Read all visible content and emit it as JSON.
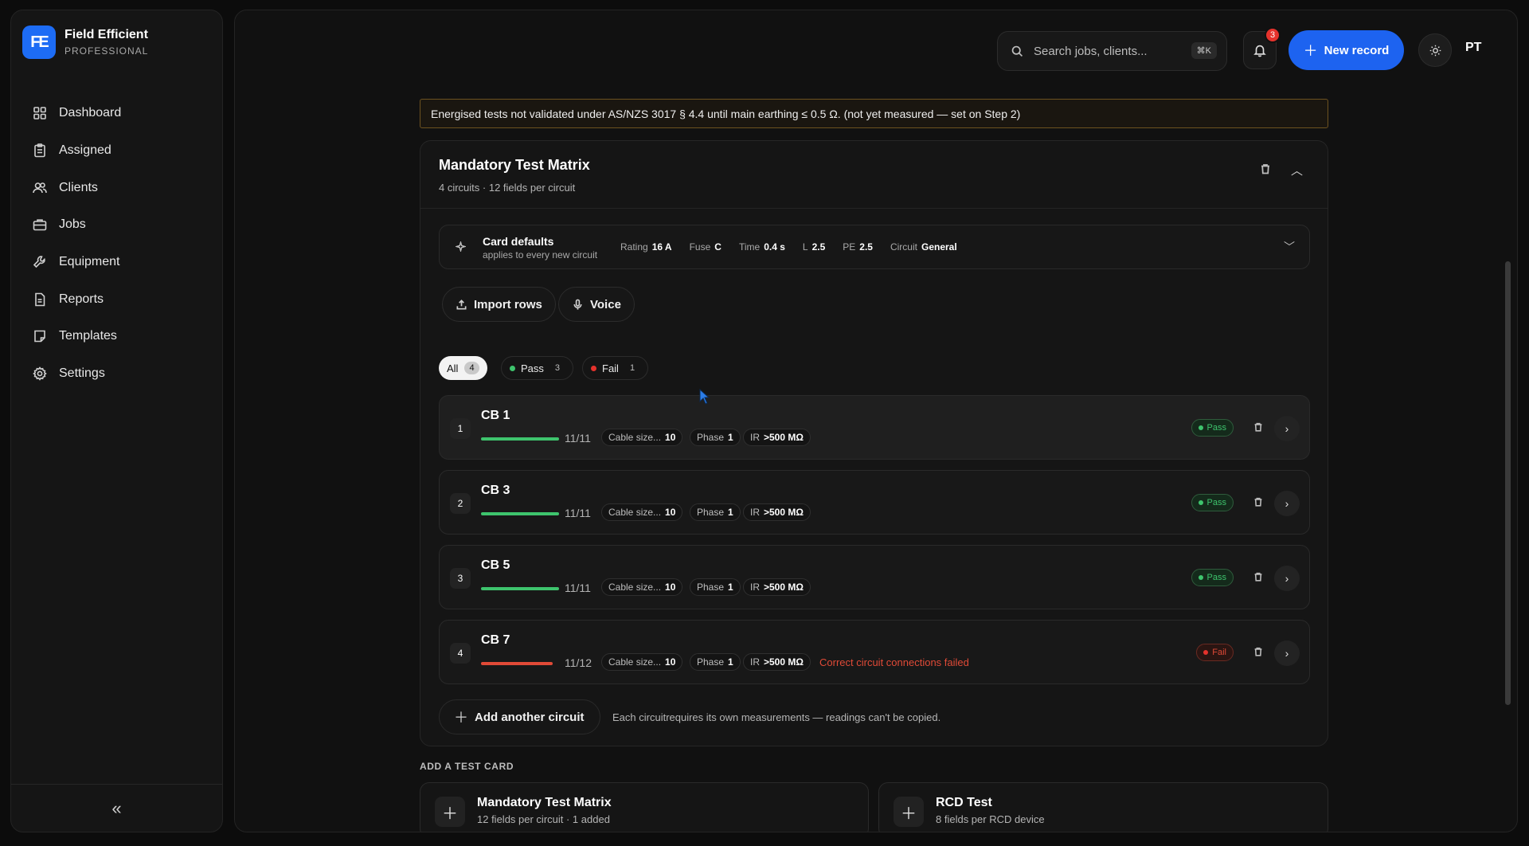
{
  "brand": {
    "logo": "FE",
    "name": "Field Efficient",
    "tier": "PROFESSIONAL"
  },
  "sidebar": {
    "items": [
      {
        "label": "Dashboard",
        "icon": "grid-icon"
      },
      {
        "label": "Assigned",
        "icon": "clipboard-icon"
      },
      {
        "label": "Clients",
        "icon": "users-icon"
      },
      {
        "label": "Jobs",
        "icon": "briefcase-icon"
      },
      {
        "label": "Equipment",
        "icon": "wrench-icon"
      },
      {
        "label": "Reports",
        "icon": "file-icon"
      },
      {
        "label": "Templates",
        "icon": "note-icon"
      },
      {
        "label": "Settings",
        "icon": "gear-icon"
      }
    ],
    "collapse": "«"
  },
  "topbar": {
    "search_placeholder": "Search jobs, clients...",
    "shortcut": "⌘K",
    "notifications": "3",
    "new_record": "New record",
    "avatar": "PT"
  },
  "warning": "Energised tests not validated under AS/NZS 3017 § 4.4 until main earthing ≤ 0.5 Ω. (not yet measured — set on Step 2)",
  "card": {
    "title": "Mandatory Test Matrix",
    "subtitle": "4 circuits · 12 fields per circuit",
    "defaults": {
      "title": "Card defaults",
      "subtitle": "applies to every new circuit",
      "chips": [
        {
          "k": "Rating",
          "v": "16 A"
        },
        {
          "k": "Fuse",
          "v": "C"
        },
        {
          "k": "Time",
          "v": "0.4 s"
        },
        {
          "k": "L",
          "v": "2.5"
        },
        {
          "k": "PE",
          "v": "2.5"
        },
        {
          "k": "Circuit",
          "v": "General"
        }
      ]
    },
    "actions": {
      "import": "Import rows",
      "voice": "Voice"
    },
    "filters": {
      "all": {
        "label": "All",
        "count": "4"
      },
      "pass": {
        "label": "Pass",
        "count": "3"
      },
      "fail": {
        "label": "Fail",
        "count": "1"
      }
    },
    "rows": [
      {
        "num": "1",
        "name": "CB 1",
        "progress": "11/11",
        "progress_fraction": 1.0,
        "cable_k": "Cable size...",
        "cable_v": "10",
        "phase_k": "Phase",
        "phase_v": "1",
        "ir_k": "IR",
        "ir_v": ">500 MΩ",
        "status": "Pass",
        "message": ""
      },
      {
        "num": "2",
        "name": "CB 3",
        "progress": "11/11",
        "progress_fraction": 1.0,
        "cable_k": "Cable size...",
        "cable_v": "10",
        "phase_k": "Phase",
        "phase_v": "1",
        "ir_k": "IR",
        "ir_v": ">500 MΩ",
        "status": "Pass",
        "message": ""
      },
      {
        "num": "3",
        "name": "CB 5",
        "progress": "11/11",
        "progress_fraction": 1.0,
        "cable_k": "Cable size...",
        "cable_v": "10",
        "phase_k": "Phase",
        "phase_v": "1",
        "ir_k": "IR",
        "ir_v": ">500 MΩ",
        "status": "Pass",
        "message": ""
      },
      {
        "num": "4",
        "name": "CB 7",
        "progress": "11/12",
        "progress_fraction": 0.917,
        "cable_k": "Cable size...",
        "cable_v": "10",
        "phase_k": "Phase",
        "phase_v": "1",
        "ir_k": "IR",
        "ir_v": ">500 MΩ",
        "status": "Fail",
        "message": "Correct circuit connections failed"
      }
    ],
    "add_circuit": "Add another circuit",
    "add_note": "Each circuitrequires its own measurements — readings can't be copied."
  },
  "add_test_card": {
    "label": "ADD A TEST CARD",
    "cards": [
      {
        "title": "Mandatory Test Matrix",
        "subtitle": "12 fields per circuit · 1 added"
      },
      {
        "title": "RCD Test",
        "subtitle": "8 fields per RCD device"
      }
    ]
  },
  "colors": {
    "accent": "#1d63f0",
    "pass": "#3ec46d",
    "fail": "#e04a37",
    "warning_border": "#6d5220"
  }
}
